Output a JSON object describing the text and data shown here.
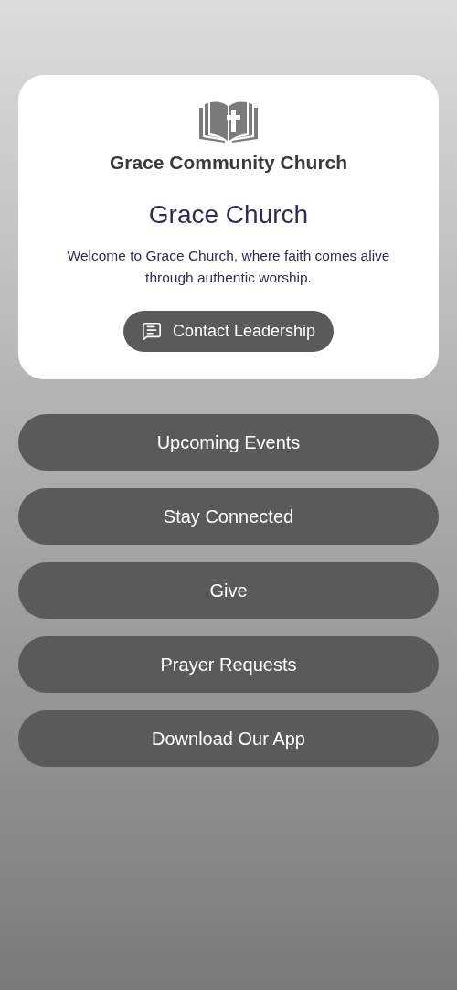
{
  "logo": {
    "text": "Grace Community Church"
  },
  "title": "Grace Church",
  "welcome": "Welcome to Grace Church, where faith comes alive through authentic worship.",
  "contact_button": "Contact Leadership",
  "links": [
    "Upcoming Events",
    "Stay Connected",
    "Give",
    "Prayer Requests",
    "Download Our App"
  ]
}
